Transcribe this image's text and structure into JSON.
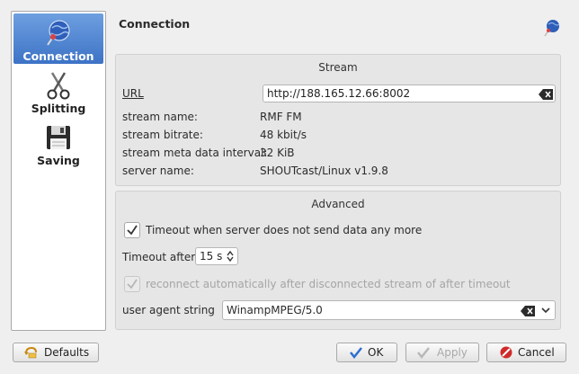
{
  "sidebar": {
    "items": [
      {
        "label": "Connection",
        "icon": "globe-pin-icon",
        "active": true
      },
      {
        "label": "Splitting",
        "icon": "scissors-icon",
        "active": false
      },
      {
        "label": "Saving",
        "icon": "floppy-disk-icon",
        "active": false
      }
    ]
  },
  "header": {
    "title": "Connection",
    "icon": "globe-pin-icon"
  },
  "stream": {
    "title": "Stream",
    "url_label": "URL",
    "url_value": "http://188.165.12.66:8002",
    "rows": [
      {
        "label": "stream name:",
        "value": "RMF FM"
      },
      {
        "label": "stream bitrate:",
        "value": "48 kbit/s"
      },
      {
        "label": "stream meta data interval:",
        "value": "32 KiB"
      },
      {
        "label": "server name:",
        "value": "SHOUTcast/Linux v1.9.8"
      }
    ]
  },
  "advanced": {
    "title": "Advanced",
    "timeout_check_label": "Timeout when server does not send data any more",
    "timeout_checked": true,
    "timeout_after_label": "Timeout after",
    "timeout_after_value": "15 s",
    "reconnect_label": "reconnect automatically after disconnected stream of after timeout",
    "reconnect_checked": true,
    "reconnect_enabled": false,
    "user_agent_label": "user agent string",
    "user_agent_value": "WinampMPEG/5.0"
  },
  "buttons": {
    "defaults": "Defaults",
    "ok": "OK",
    "apply": "Apply",
    "cancel": "Cancel"
  },
  "colors": {
    "accent": "#3d73c6",
    "cancel_red": "#d02a2a",
    "ok_blue": "#2d6fcf"
  }
}
